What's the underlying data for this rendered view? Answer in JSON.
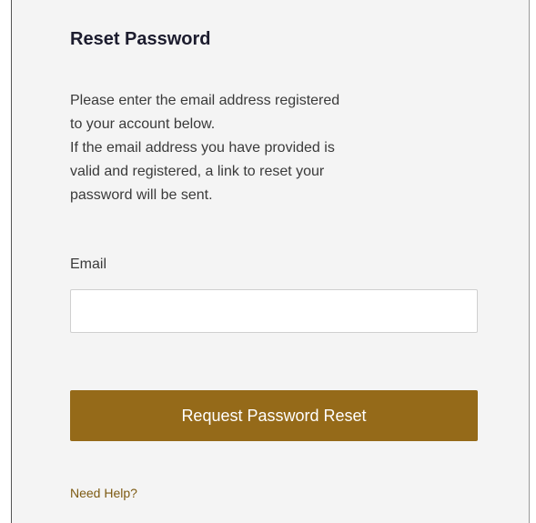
{
  "form": {
    "title": "Reset Password",
    "description_lines": [
      "Please enter the email address registered",
      "to your account below.",
      "If the email address you have provided is",
      "valid and registered, a link to reset your",
      "password will be sent."
    ],
    "email_label": "Email",
    "email_value": "",
    "email_placeholder": "",
    "submit_label": "Request Password Reset",
    "help_link": "Need Help?"
  },
  "colors": {
    "panel_background": "#f4f4f4",
    "button_background": "#956a19",
    "button_text": "#ffffff",
    "link": "#7d5a12",
    "title_text": "#1c1c2e"
  }
}
